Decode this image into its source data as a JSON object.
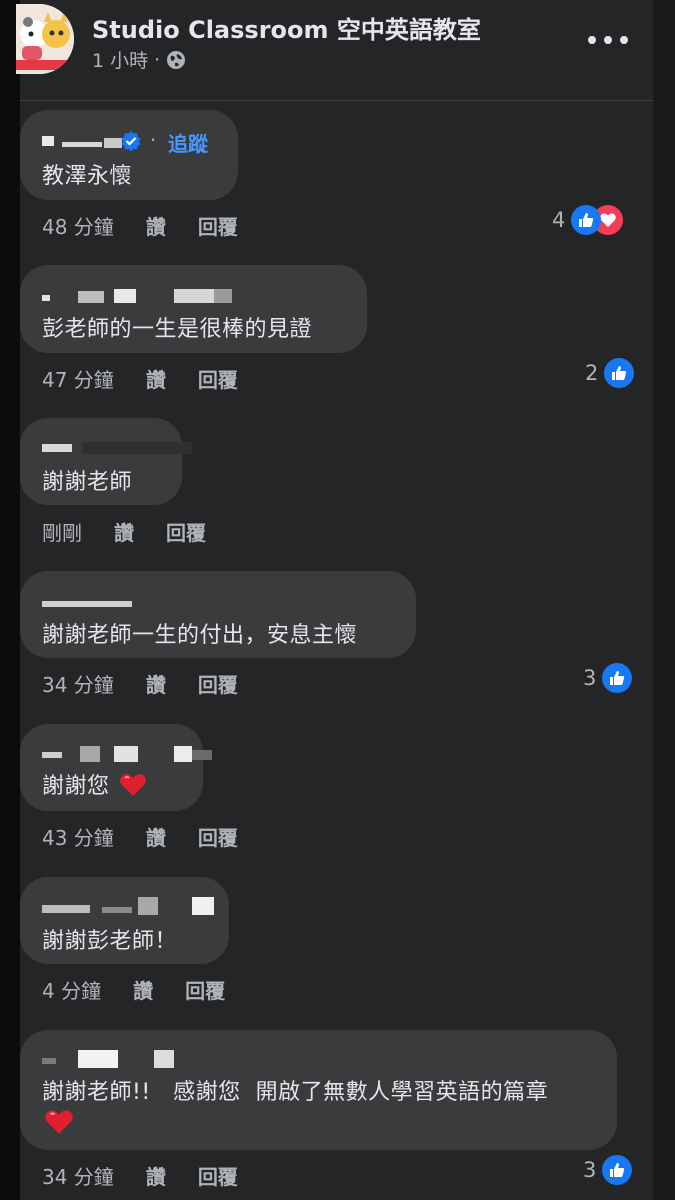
{
  "post": {
    "page_name": "Studio Classroom 空中英語教室",
    "time": "1 小時",
    "separator": "·",
    "privacy_icon": "globe-icon",
    "more_icon": "more-icon"
  },
  "labels": {
    "like": "讚",
    "reply": "回覆",
    "follow": "追蹤",
    "dot": "·"
  },
  "colors": {
    "background": "#242526",
    "bubble": "#3a3b3c",
    "accent": "#1877f2",
    "love": "#f33e58",
    "follow": "#4599ff"
  },
  "comments": [
    {
      "text": "教澤永懷",
      "time": "48 分鐘",
      "reactions": "4",
      "reaction_icons": [
        "like-icon",
        "love-icon"
      ],
      "verified": true
    },
    {
      "text": "彭老師的一生是很棒的見證",
      "time": "47 分鐘",
      "reactions": "2",
      "reaction_icons": [
        "like-icon"
      ]
    },
    {
      "text": "謝謝老師",
      "time": "剛剛"
    },
    {
      "text": "謝謝老師一生的付出，安息主懷",
      "time": "34 分鐘",
      "reactions": "3",
      "reaction_icons": [
        "like-icon"
      ]
    },
    {
      "text": "謝謝您",
      "emoji": "❤️",
      "time": "43 分鐘"
    },
    {
      "text": "謝謝彭老師！",
      "time": "4 分鐘"
    },
    {
      "text": "謝謝老師!!   感謝您  開啟了無數人學習英語的篇章",
      "emoji": "❤️",
      "time": "34 分鐘",
      "reactions": "3",
      "reaction_icons": [
        "like-icon"
      ]
    }
  ]
}
